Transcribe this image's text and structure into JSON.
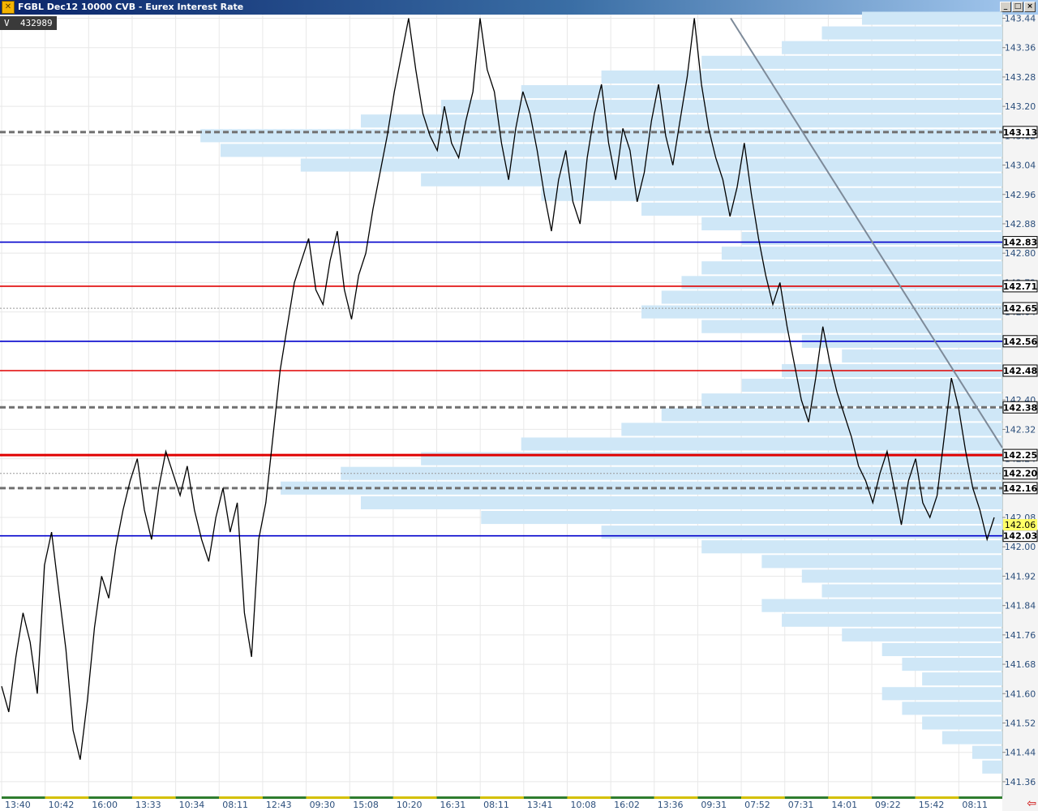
{
  "window": {
    "title": "FGBL Dec12 10000 CVB - Eurex Interest Rate",
    "buttons": [
      "_",
      "□",
      "×"
    ]
  },
  "volume": {
    "label": "V",
    "value": "432989"
  },
  "colors": {
    "price_line": "#000000",
    "profile_fill": "#cfe7f7",
    "blue_level": "#0000cc",
    "red_level": "#e00000",
    "gray_dashed": "#707070",
    "trend_line": "#7d8a99",
    "axis_bg": "#f4f4f4",
    "grid": "#e8e8e8"
  },
  "chart_data": {
    "type": "line",
    "title": "",
    "xlabel": "",
    "ylabel": "",
    "ylim": [
      141.32,
      143.45
    ],
    "yticks": [
      "143.44",
      "143.36",
      "143.28",
      "143.20",
      "143.12",
      "143.04",
      "142.96",
      "142.88",
      "142.80",
      "142.72",
      "142.64",
      "142.56",
      "142.48",
      "142.40",
      "142.32",
      "142.24",
      "142.16",
      "142.08",
      "142.00",
      "141.92",
      "141.84",
      "141.76",
      "141.68",
      "141.60",
      "141.52",
      "141.44",
      "141.36"
    ],
    "xticks": [
      "13:40",
      "10:42",
      "16:00",
      "13:33",
      "10:34",
      "08:11",
      "12:43",
      "09:30",
      "15:08",
      "10:20",
      "16:31",
      "08:11",
      "13:41",
      "10:08",
      "16:02",
      "13:36",
      "09:31",
      "07:52",
      "07:31",
      "14:01",
      "09:22",
      "15:42",
      "08:11"
    ],
    "price_series": [
      141.62,
      141.55,
      141.7,
      141.82,
      141.74,
      141.6,
      141.95,
      142.04,
      141.88,
      141.72,
      141.5,
      141.42,
      141.58,
      141.78,
      141.92,
      141.86,
      142.0,
      142.1,
      142.18,
      142.24,
      142.1,
      142.02,
      142.16,
      142.26,
      142.2,
      142.14,
      142.22,
      142.1,
      142.02,
      141.96,
      142.08,
      142.16,
      142.04,
      142.12,
      141.82,
      141.7,
      142.02,
      142.12,
      142.3,
      142.48,
      142.6,
      142.72,
      142.78,
      142.84,
      142.7,
      142.66,
      142.78,
      142.86,
      142.7,
      142.62,
      142.74,
      142.8,
      142.92,
      143.02,
      143.12,
      143.24,
      143.34,
      143.44,
      143.3,
      143.18,
      143.12,
      143.08,
      143.2,
      143.1,
      143.06,
      143.16,
      143.24,
      143.44,
      143.3,
      143.24,
      143.1,
      143.0,
      143.14,
      143.24,
      143.18,
      143.08,
      142.96,
      142.86,
      143.0,
      143.08,
      142.94,
      142.88,
      143.06,
      143.18,
      143.26,
      143.1,
      143.0,
      143.14,
      143.08,
      142.94,
      143.02,
      143.16,
      143.26,
      143.12,
      143.04,
      143.16,
      143.28,
      143.44,
      143.26,
      143.14,
      143.06,
      143.0,
      142.9,
      142.98,
      143.1,
      142.96,
      142.84,
      142.74,
      142.66,
      142.72,
      142.6,
      142.5,
      142.4,
      142.34,
      142.46,
      142.6,
      142.5,
      142.42,
      142.36,
      142.3,
      142.22,
      142.18,
      142.12,
      142.2,
      142.26,
      142.16,
      142.06,
      142.18,
      142.24,
      142.12,
      142.08,
      142.14,
      142.3,
      142.46,
      142.38,
      142.26,
      142.16,
      142.1,
      142.02,
      142.08
    ],
    "levels": [
      {
        "label": "142.83",
        "value": 142.83,
        "style": "blue"
      },
      {
        "label": "142.71",
        "value": 142.71,
        "style": "red"
      },
      {
        "label": "142.65",
        "value": 142.65,
        "style": "thin"
      },
      {
        "label": "142.56",
        "value": 142.56,
        "style": "blue"
      },
      {
        "label": "142.48",
        "value": 142.48,
        "style": "red"
      },
      {
        "label": "142.38",
        "value": 142.38,
        "style": "dashed"
      },
      {
        "label": "142.25",
        "value": 142.25,
        "style": "red-thick"
      },
      {
        "label": "142.20",
        "value": 142.2,
        "style": "thin"
      },
      {
        "label": "142.16",
        "value": 142.16,
        "style": "dashed"
      },
      {
        "label": "142.03",
        "value": 142.03,
        "style": "blue"
      },
      {
        "label": "143.13",
        "value": 143.13,
        "style": "dashed"
      }
    ],
    "last_price": {
      "label": "142.06",
      "value": 142.06
    },
    "trendline": {
      "from": [
        0.729,
        143.44
      ],
      "to": [
        1.0,
        142.27
      ]
    },
    "volume_profile": {
      "prices": [
        143.44,
        143.4,
        143.36,
        143.32,
        143.28,
        143.24,
        143.2,
        143.16,
        143.12,
        143.08,
        143.04,
        143.0,
        142.96,
        142.92,
        142.88,
        142.84,
        142.8,
        142.76,
        142.72,
        142.68,
        142.64,
        142.6,
        142.56,
        142.52,
        142.48,
        142.44,
        142.4,
        142.36,
        142.32,
        142.28,
        142.24,
        142.2,
        142.16,
        142.12,
        142.08,
        142.04,
        142.0,
        141.96,
        141.92,
        141.88,
        141.84,
        141.8,
        141.76,
        141.72,
        141.68,
        141.64,
        141.6,
        141.56,
        141.52,
        141.48,
        141.44,
        141.4
      ],
      "lengths": [
        0.14,
        0.18,
        0.22,
        0.3,
        0.4,
        0.48,
        0.56,
        0.64,
        0.8,
        0.78,
        0.7,
        0.58,
        0.46,
        0.36,
        0.3,
        0.26,
        0.28,
        0.3,
        0.32,
        0.34,
        0.36,
        0.3,
        0.2,
        0.16,
        0.22,
        0.26,
        0.3,
        0.34,
        0.38,
        0.48,
        0.58,
        0.66,
        0.72,
        0.64,
        0.52,
        0.4,
        0.3,
        0.24,
        0.2,
        0.18,
        0.24,
        0.22,
        0.16,
        0.12,
        0.1,
        0.08,
        0.12,
        0.1,
        0.08,
        0.06,
        0.03,
        0.02
      ]
    }
  }
}
